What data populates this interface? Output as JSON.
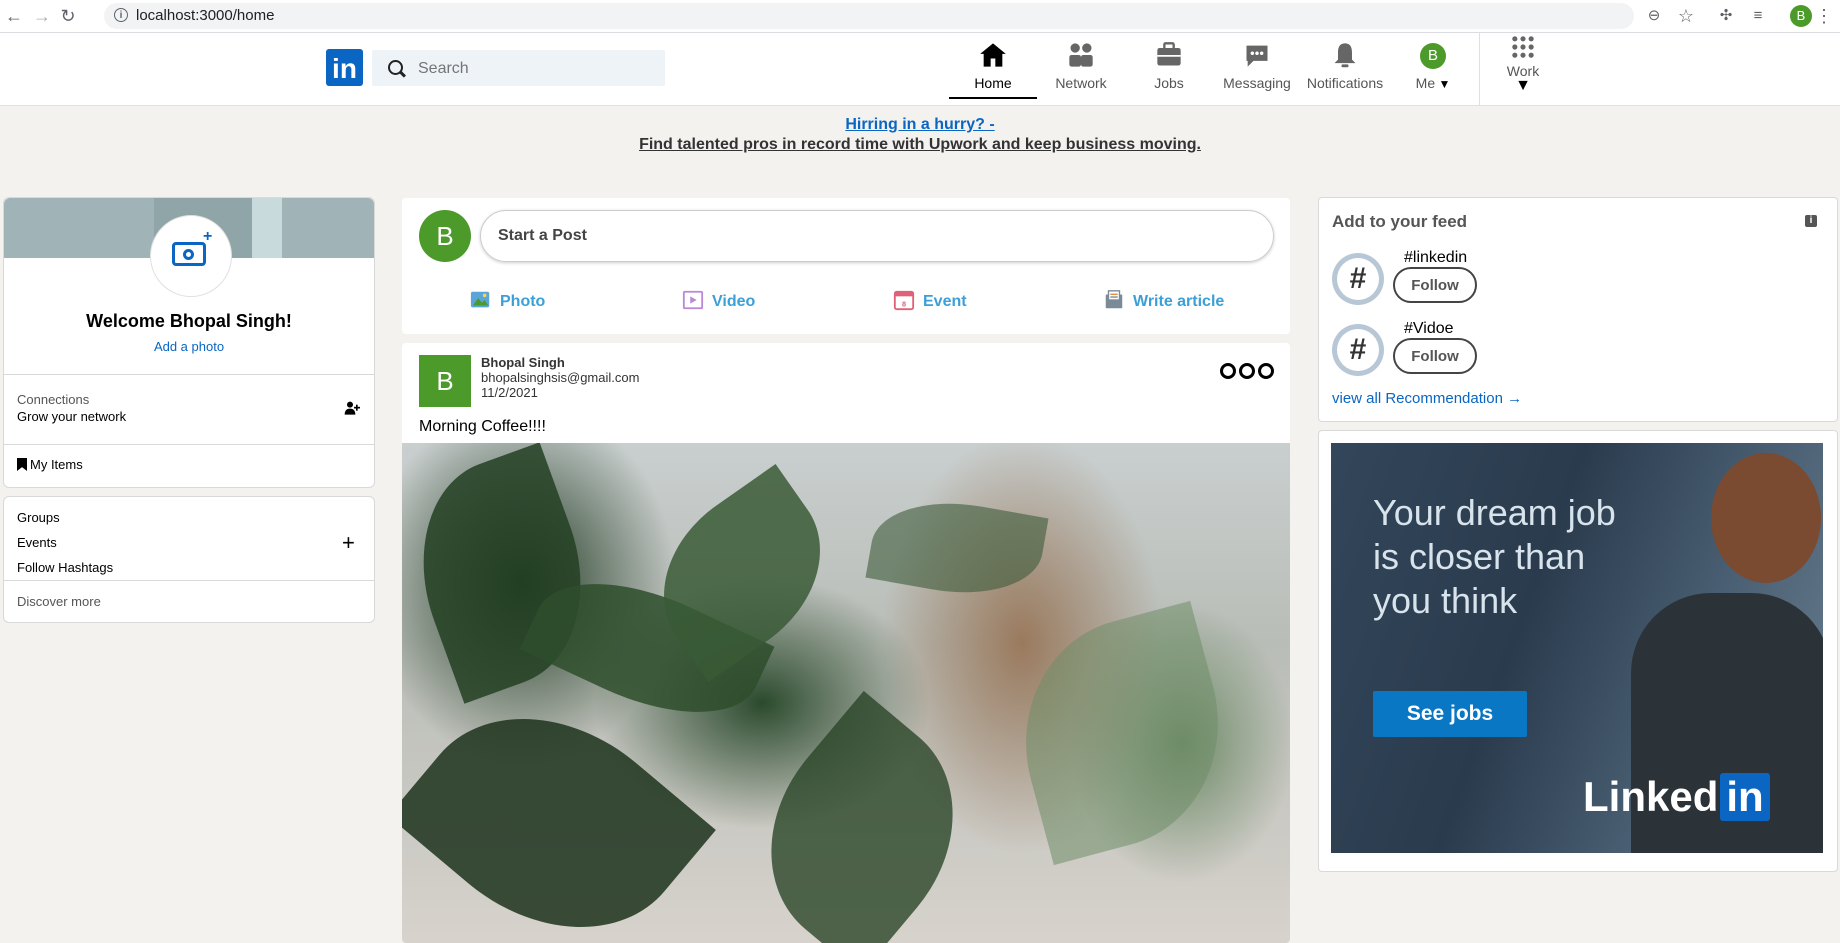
{
  "browser": {
    "url": "localhost:3000/home",
    "profile_initial": "B"
  },
  "header": {
    "logo_text": "in",
    "search_placeholder": "Search",
    "nav": {
      "home": "Home",
      "network": "Network",
      "jobs": "Jobs",
      "messaging": "Messaging",
      "notifications": "Notifications",
      "me": "Me",
      "me_initial": "B",
      "work": "Work"
    }
  },
  "promo": {
    "line1": "Hirring in a hurry? -",
    "line2": "Find talented pros in record time with Upwork and keep business moving."
  },
  "profile": {
    "welcome": "Welcome Bhopal Singh!",
    "add_photo": "Add a photo",
    "connections_label": "Connections",
    "connections_sub": "Grow your network",
    "my_items": "My Items"
  },
  "groups": {
    "items": [
      "Groups",
      "Events",
      "Follow Hashtags"
    ],
    "discover": "Discover more"
  },
  "post_box": {
    "avatar_initial": "B",
    "placeholder": "Start a Post",
    "actions": {
      "photo": "Photo",
      "video": "Video",
      "event": "Event",
      "article": "Write article"
    }
  },
  "feed_post": {
    "avatar_initial": "B",
    "author": "Bhopal Singh",
    "email": "bhopalsinghsis@gmail.com",
    "date": "11/2/2021",
    "text": "Morning Coffee!!!!"
  },
  "add_feed": {
    "title": "Add to your feed",
    "info": "i",
    "items": [
      {
        "tag": "#linkedin",
        "button": "Follow"
      },
      {
        "tag": "#Vidoe",
        "button": "Follow"
      }
    ],
    "view_all": "view all Recommendation"
  },
  "ad": {
    "headline": "Your dream job is closer than you think",
    "button": "See jobs",
    "brand_left": "Linked",
    "brand_right": "in"
  },
  "colors": {
    "brand": "#0a66c2",
    "avatar_green": "#4c9a2a",
    "action_blue": "#3b9fd8"
  }
}
